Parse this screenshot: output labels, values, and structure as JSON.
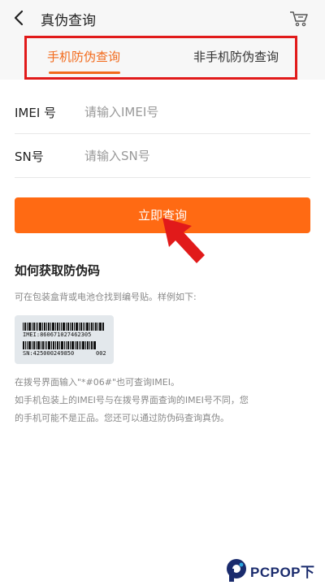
{
  "header": {
    "title": "真伪查询",
    "back_icon": "back-chevron-icon",
    "cart_icon": "cart-icon"
  },
  "tabs": [
    {
      "label": "手机防伪查询",
      "active": true
    },
    {
      "label": "非手机防伪查询",
      "active": false
    }
  ],
  "form": {
    "imei": {
      "label": "IMEI 号",
      "placeholder": "请输入IMEI号",
      "value": ""
    },
    "sn": {
      "label": "SN号",
      "placeholder": "请输入SN号",
      "value": ""
    }
  },
  "query_button": {
    "label": "立即查询"
  },
  "help": {
    "title": "如何获取防伪码",
    "description": "可在包装盒背或电池仓找到编号贴。样例如下:",
    "sample": {
      "imei": "IMEI:860671027462305",
      "sn": "SN:425000249850",
      "code": "002"
    },
    "notes": [
      "在拨号界面输入\"*#06#\"也可查询IMEI。",
      "如手机包装上的IMEI号与在拨号界面查询的IMEI号不同，您",
      "的手机可能不是正品。您还可以通过防伪码查询真伪。"
    ]
  },
  "watermark": {
    "text": "PCPOP下载"
  },
  "colors": {
    "accent": "#ff6a13",
    "active_tab": "#f26a1b",
    "annotation_red": "#e11a1a"
  }
}
